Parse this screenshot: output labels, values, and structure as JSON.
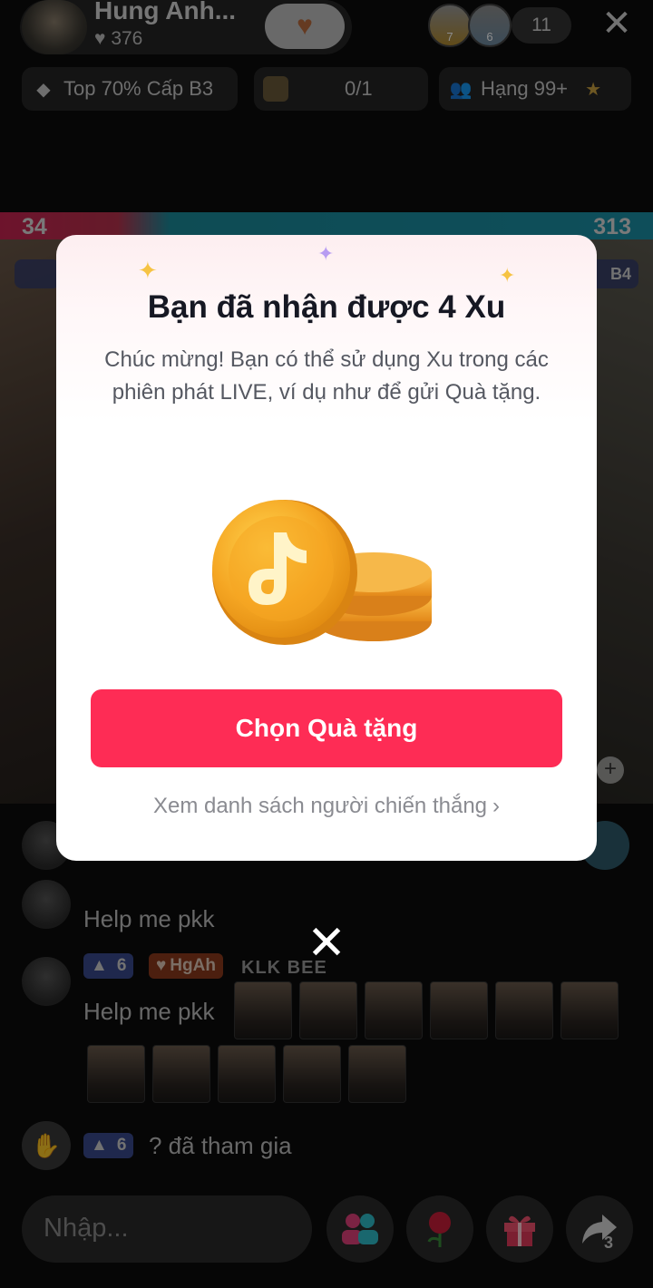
{
  "header": {
    "host_name": "Hung Anh...",
    "host_likes": "376",
    "viewer_badges": [
      "7",
      "6"
    ],
    "viewer_count": "11",
    "close_label": "✕"
  },
  "stats": {
    "rank_tier": "Top 70% Cấp B3",
    "goal_progress": "0/1",
    "hourly_rank": "Hạng 99+"
  },
  "battle": {
    "left_score": "34",
    "right_score": "313",
    "right_tier": "B4",
    "colors": {
      "left": "#c72451",
      "right": "#1b8fa5"
    }
  },
  "chat": {
    "messages": [
      {
        "text": "Help me pkk"
      },
      {
        "level": "6",
        "fan_badge": "HgAh",
        "extra": "KLK  BEE",
        "text": "Help me pkk"
      },
      {
        "level": "6",
        "text": "? đã tham gia"
      }
    ]
  },
  "bottom_bar": {
    "input_placeholder": "Nhập...",
    "share_count": "3"
  },
  "modal": {
    "title": "Bạn đã nhận được 4 Xu",
    "body": "Chúc mừng! Bạn có thể sử dụng Xu trong các phiên phát LIVE, ví dụ như để gửi Quà tặng.",
    "cta_label": "Chọn Quà tặng",
    "link_label": "Xem danh sách người chiến thắng",
    "accent_color": "#fe2c55"
  },
  "dismiss_label": "✕"
}
